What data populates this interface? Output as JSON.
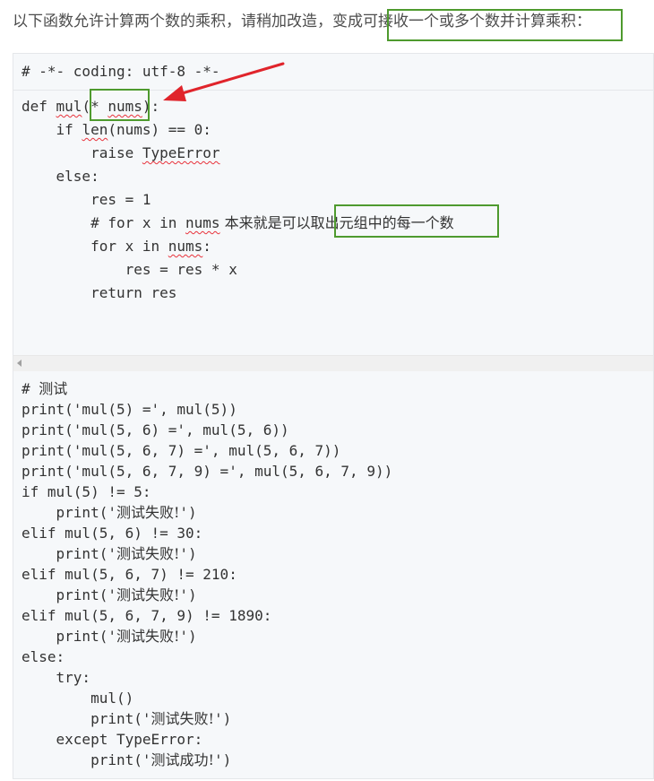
{
  "instruction": {
    "prefix": "以下函数允许计算两个数的乘积，请稍加改造，变成",
    "highlighted": "可接收一个或多个数并计算乘积："
  },
  "code_header": "# -*- coding: utf-8 -*-",
  "function_code": {
    "l1_a": "def ",
    "l1_name": "mul",
    "l1_paren": "(",
    "l1_star": "* ",
    "l1_param": "nums",
    "l1_end": "):",
    "l2_a": "    if ",
    "l2_len": "len",
    "l2_b": "(nums) == 0:",
    "l3_a": "        raise ",
    "l3_err": "TypeError",
    "l4": "    else:",
    "l5": "        res = 1",
    "l6_a": "        # for x in ",
    "l6_nums": "nums",
    "l6_cmt1": " 本来就是可以",
    "l6_cmt2": "取出元组中的每一个数",
    "l7_a": "        for x in ",
    "l7_nums": "nums",
    "l7_b": ":",
    "l8": "            res = res * x",
    "l9": "        return res"
  },
  "test_code": [
    {
      "code": "# ",
      "zh": "测试",
      "tail": ""
    },
    {
      "code": "print('mul(5) =', mul(5))",
      "zh": "",
      "tail": ""
    },
    {
      "code": "print('mul(5, 6) =', mul(5, 6))",
      "zh": "",
      "tail": ""
    },
    {
      "code": "print('mul(5, 6, 7) =', mul(5, 6, 7))",
      "zh": "",
      "tail": ""
    },
    {
      "code": "print('mul(5, 6, 7, 9) =', mul(5, 6, 7, 9))",
      "zh": "",
      "tail": ""
    },
    {
      "code": "if mul(5) != 5:",
      "zh": "",
      "tail": ""
    },
    {
      "code": "    print('",
      "zh": "测试失败!",
      "tail": "')"
    },
    {
      "code": "elif mul(5, 6) != 30:",
      "zh": "",
      "tail": ""
    },
    {
      "code": "    print('",
      "zh": "测试失败!",
      "tail": "')"
    },
    {
      "code": "elif mul(5, 6, 7) != 210:",
      "zh": "",
      "tail": ""
    },
    {
      "code": "    print('",
      "zh": "测试失败!",
      "tail": "')"
    },
    {
      "code": "elif mul(5, 6, 7, 9) != 1890:",
      "zh": "",
      "tail": ""
    },
    {
      "code": "    print('",
      "zh": "测试失败!",
      "tail": "')"
    },
    {
      "code": "else:",
      "zh": "",
      "tail": ""
    },
    {
      "code": "    try:",
      "zh": "",
      "tail": ""
    },
    {
      "code": "        mul()",
      "zh": "",
      "tail": ""
    },
    {
      "code": "        print('",
      "zh": "测试失败!",
      "tail": "')"
    },
    {
      "code": "    except TypeError:",
      "zh": "",
      "tail": ""
    },
    {
      "code": "        print('",
      "zh": "测试成功!",
      "tail": "')"
    }
  ],
  "colors": {
    "highlight_box": "#4e9a2e",
    "arrow": "#e0242b",
    "squiggle": "#e8323b"
  }
}
